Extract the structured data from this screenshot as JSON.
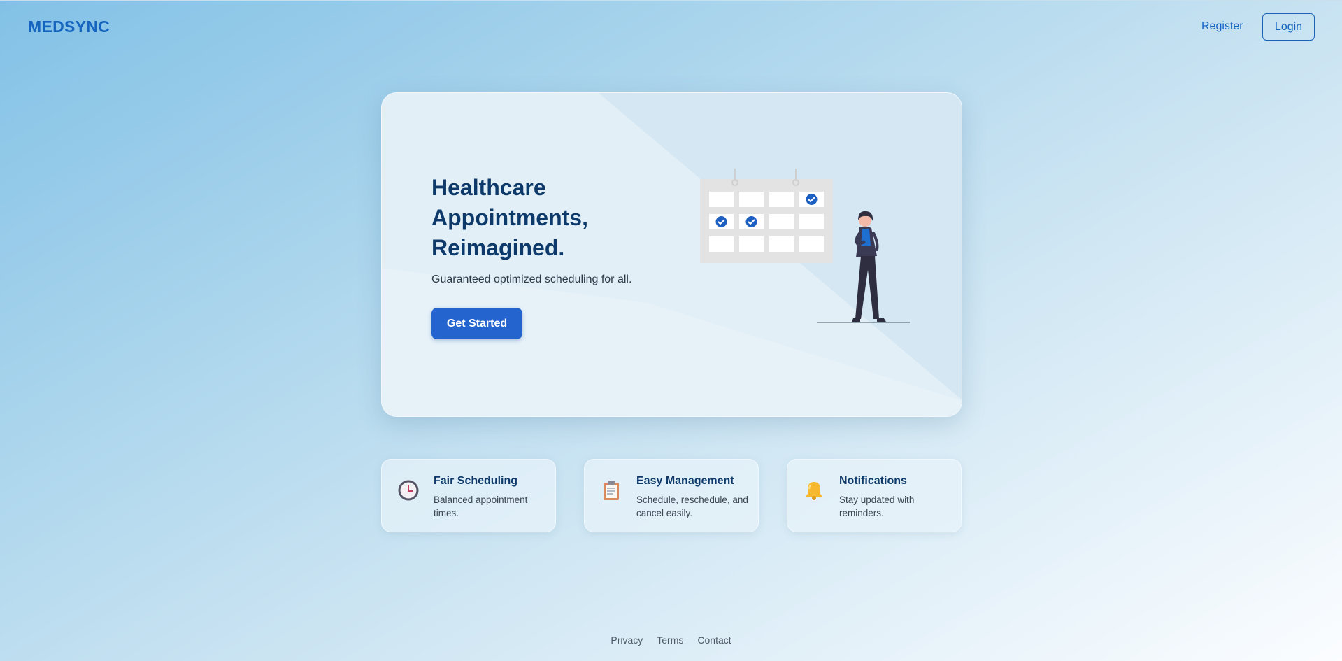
{
  "header": {
    "logo": "MEDSYNC",
    "register_label": "Register",
    "login_label": "Login"
  },
  "hero": {
    "title": "Healthcare Appointments, Reimagined.",
    "subtitle": "Guaranteed optimized scheduling for all.",
    "cta_label": "Get Started",
    "illustration": "calendar-with-person-illustration"
  },
  "features": [
    {
      "icon": "clock-icon",
      "title": "Fair Scheduling",
      "description": "Balanced appointment times."
    },
    {
      "icon": "clipboard-icon",
      "title": "Easy Management",
      "description": "Schedule, reschedule, and cancel easily."
    },
    {
      "icon": "bell-icon",
      "title": "Notifications",
      "description": "Stay updated with reminders."
    }
  ],
  "footer": {
    "links": [
      "Privacy",
      "Terms",
      "Contact"
    ]
  },
  "colors": {
    "brand": "#1565c0",
    "heading": "#0d3a6a",
    "cta": "#2464cf"
  }
}
